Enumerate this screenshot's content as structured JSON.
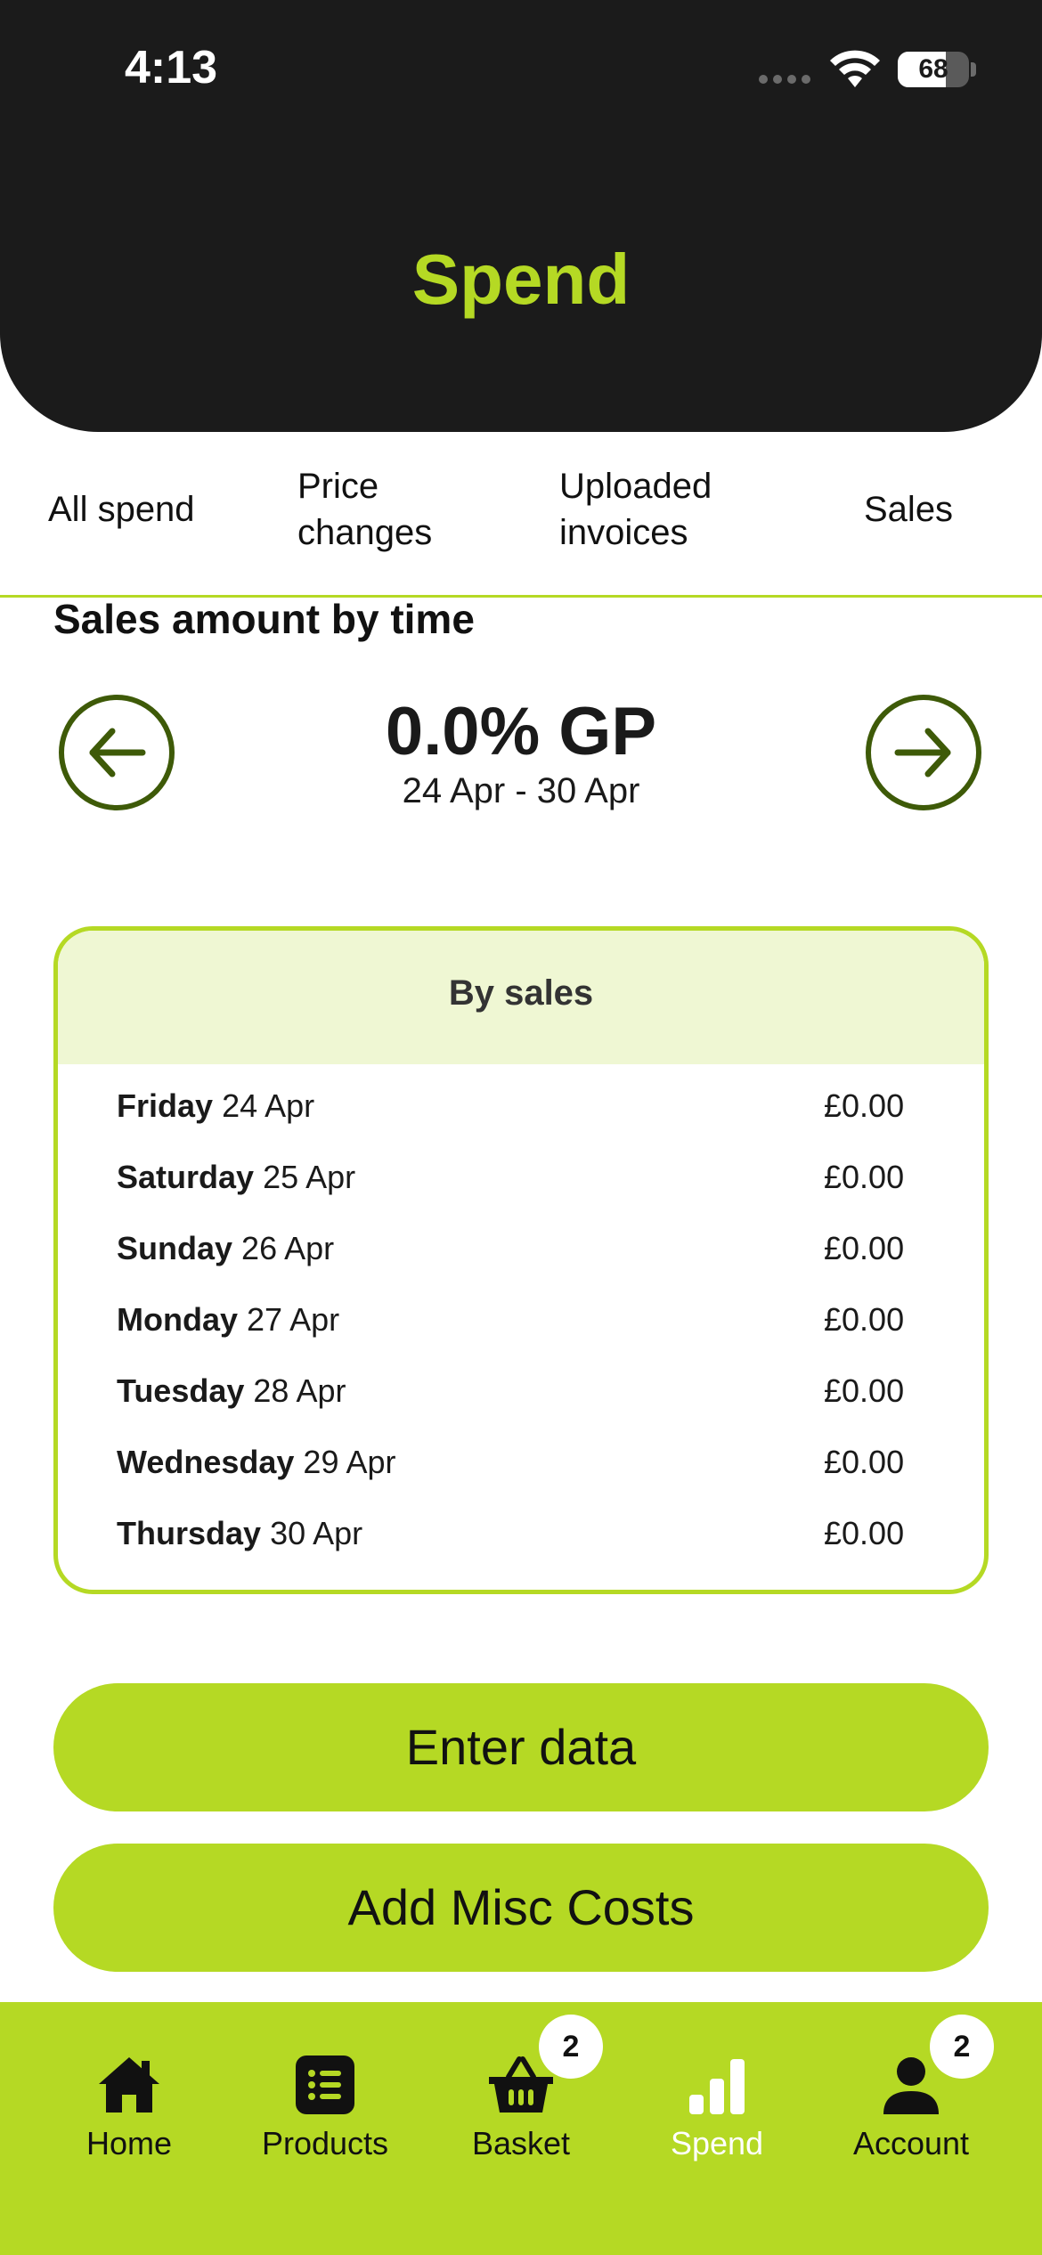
{
  "status": {
    "time": "4:13",
    "battery": "68",
    "battery_level": 0.68
  },
  "header": {
    "title": "Spend"
  },
  "tabs": [
    {
      "label": "All spend"
    },
    {
      "label": "Price\nchanges"
    },
    {
      "label": "Uploaded\ninvoices"
    },
    {
      "label": "Sales"
    }
  ],
  "section": {
    "title": "Sales amount by time"
  },
  "summary": {
    "gp": "0.0% GP",
    "range": "24 Apr - 30 Apr"
  },
  "card": {
    "title": "By sales",
    "rows": [
      {
        "day": "Friday",
        "date": "24 Apr",
        "amount": "£0.00"
      },
      {
        "day": "Saturday",
        "date": "25 Apr",
        "amount": "£0.00"
      },
      {
        "day": "Sunday",
        "date": "26 Apr",
        "amount": "£0.00"
      },
      {
        "day": "Monday",
        "date": "27 Apr",
        "amount": "£0.00"
      },
      {
        "day": "Tuesday",
        "date": "28 Apr",
        "amount": "£0.00"
      },
      {
        "day": "Wednesday",
        "date": "29 Apr",
        "amount": "£0.00"
      },
      {
        "day": "Thursday",
        "date": "30 Apr",
        "amount": "£0.00"
      }
    ]
  },
  "buttons": {
    "enter_data": "Enter data",
    "misc_costs": "Add Misc Costs"
  },
  "bottom_nav": {
    "items": [
      {
        "label": "Home",
        "icon": "home-icon"
      },
      {
        "label": "Products",
        "icon": "list-icon"
      },
      {
        "label": "Basket",
        "icon": "basket-icon",
        "badge": "2"
      },
      {
        "label": "Spend",
        "icon": "bar-chart-icon",
        "active": true
      },
      {
        "label": "Account",
        "icon": "person-icon",
        "badge": "2"
      }
    ]
  },
  "colors": {
    "accent": "#b5d924",
    "header_bg": "#1b1b1b",
    "arrow": "#3e5a08",
    "card_head": "#eff7d3"
  }
}
